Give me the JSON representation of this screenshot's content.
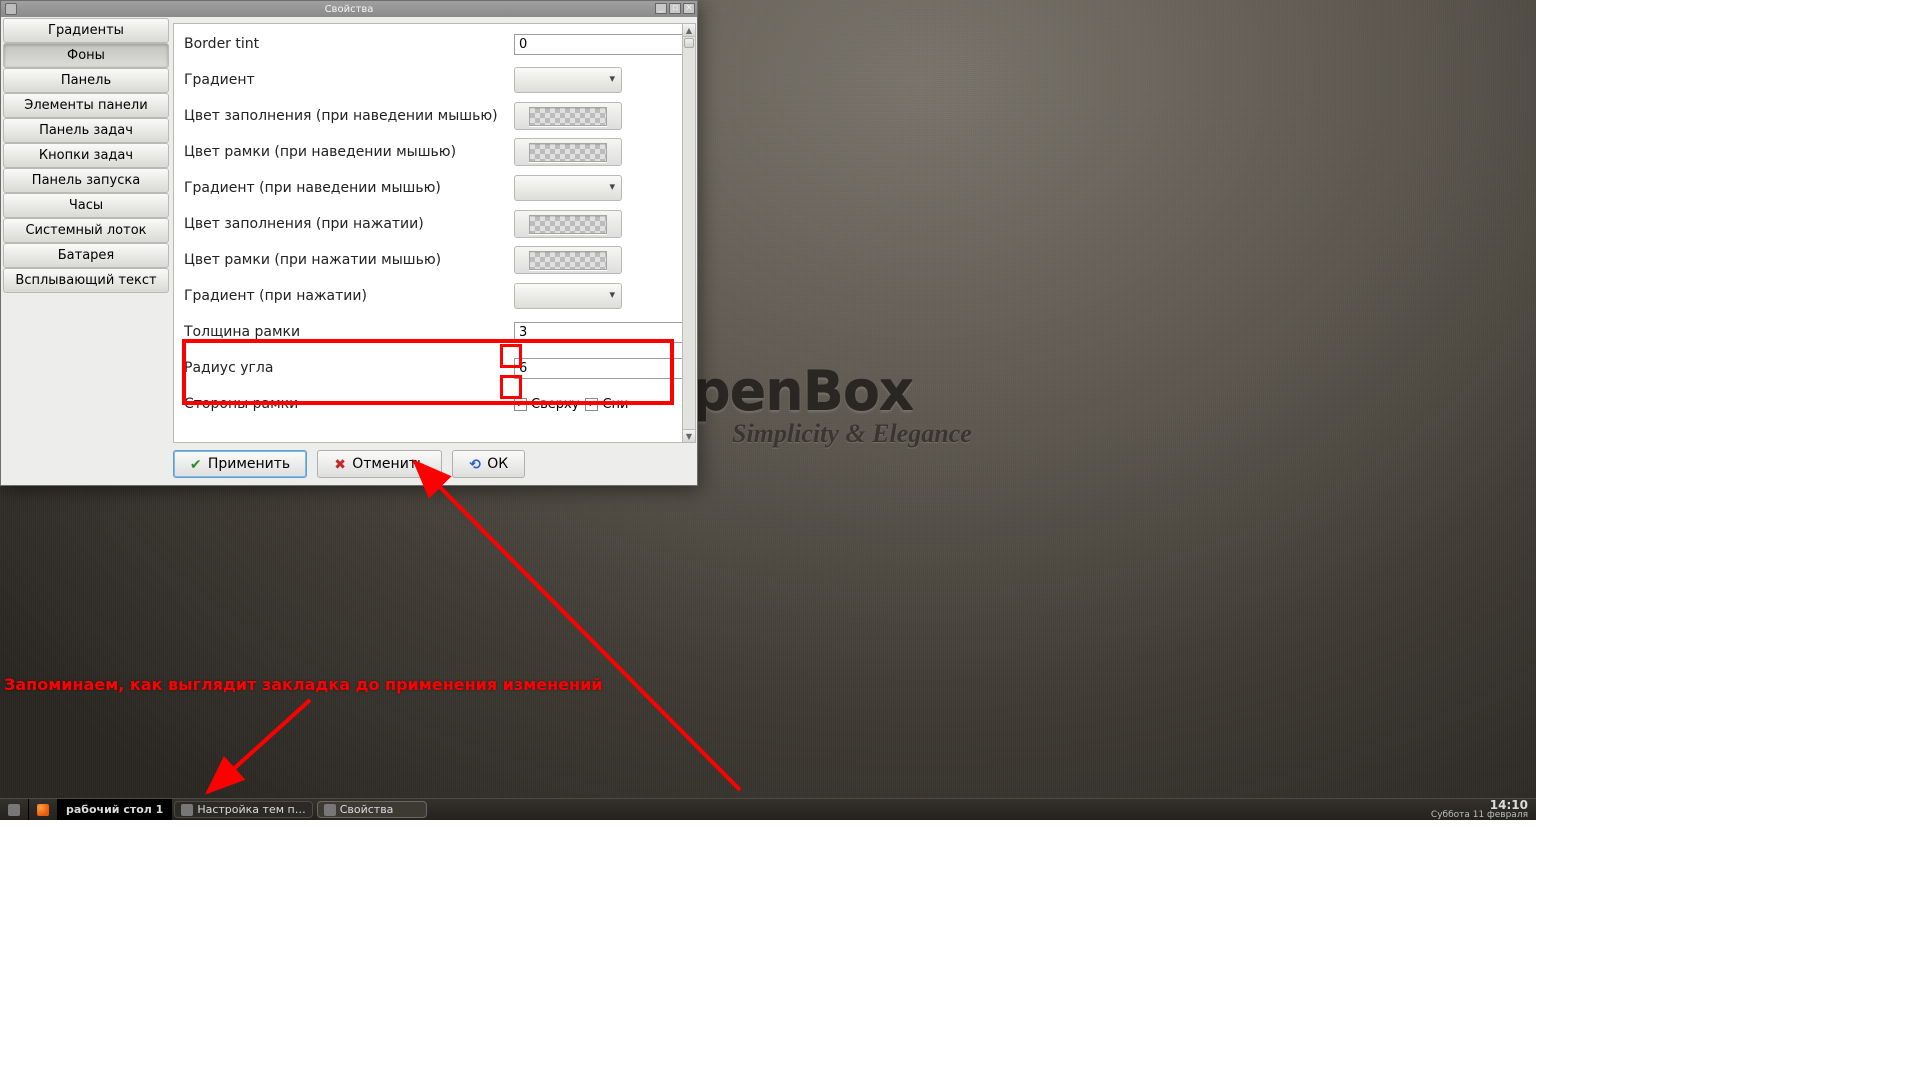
{
  "window": {
    "title": "Свойства"
  },
  "sidebar": {
    "items": [
      "Градиенты",
      "Фоны",
      "Панель",
      "Элементы панели",
      "Панель задач",
      "Кнопки задач",
      "Панель запуска",
      "Часы",
      "Системный лоток",
      "Батарея",
      "Всплывающий текст"
    ],
    "active_index": 1
  },
  "form": {
    "rows": [
      {
        "label": "Border tint",
        "type": "spin",
        "value": "0"
      },
      {
        "label": "Градиент",
        "type": "combo"
      },
      {
        "label": "Цвет заполнения (при наведении мышью)",
        "type": "color"
      },
      {
        "label": "Цвет рамки (при наведении мышью)",
        "type": "color"
      },
      {
        "label": "Градиент (при наведении мышью)",
        "type": "combo"
      },
      {
        "label": "Цвет заполнения (при нажатии)",
        "type": "color"
      },
      {
        "label": "Цвет рамки (при нажатии мышью)",
        "type": "color"
      },
      {
        "label": "Градиент (при нажатии)",
        "type": "combo"
      },
      {
        "label": "Толщина рамки",
        "type": "spin",
        "value": "3"
      },
      {
        "label": "Радиус угла",
        "type": "spin",
        "value": "6"
      }
    ],
    "sides": {
      "label": "Стороны рамки",
      "checks": [
        {
          "label": "Сверху",
          "checked": true
        },
        {
          "label": "Сни",
          "checked": true
        }
      ]
    }
  },
  "buttons": {
    "apply": "Применить",
    "cancel": "Отменить",
    "ok": "ОК"
  },
  "brand": {
    "title": "penBox",
    "subtitle": "Simplicity & Elegance"
  },
  "annotation": "Запоминаем, как выглядит закладка до применения изменений",
  "taskbar": {
    "workspace": "рабочий стол 1",
    "tasks": [
      {
        "label": "Настройка тем п…",
        "active": false
      },
      {
        "label": "Свойства",
        "active": true
      }
    ],
    "clock": "14:10",
    "date": "Суббота 11 февраля"
  }
}
